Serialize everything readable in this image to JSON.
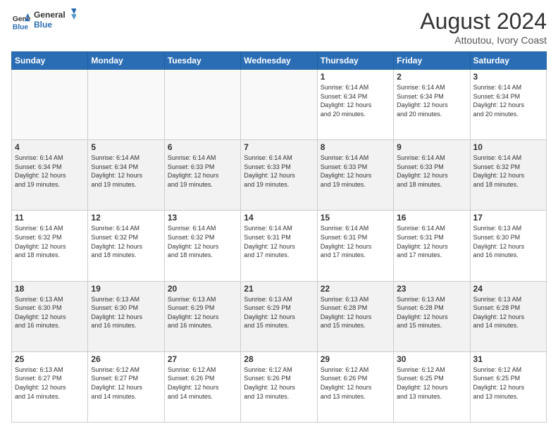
{
  "logo": {
    "line1": "General",
    "line2": "Blue"
  },
  "title": "August 2024",
  "subtitle": "Attoutou, Ivory Coast",
  "headers": [
    "Sunday",
    "Monday",
    "Tuesday",
    "Wednesday",
    "Thursday",
    "Friday",
    "Saturday"
  ],
  "weeks": [
    [
      {
        "day": "",
        "info": ""
      },
      {
        "day": "",
        "info": ""
      },
      {
        "day": "",
        "info": ""
      },
      {
        "day": "",
        "info": ""
      },
      {
        "day": "1",
        "info": "Sunrise: 6:14 AM\nSunset: 6:34 PM\nDaylight: 12 hours\nand 20 minutes."
      },
      {
        "day": "2",
        "info": "Sunrise: 6:14 AM\nSunset: 6:34 PM\nDaylight: 12 hours\nand 20 minutes."
      },
      {
        "day": "3",
        "info": "Sunrise: 6:14 AM\nSunset: 6:34 PM\nDaylight: 12 hours\nand 20 minutes."
      }
    ],
    [
      {
        "day": "4",
        "info": "Sunrise: 6:14 AM\nSunset: 6:34 PM\nDaylight: 12 hours\nand 19 minutes."
      },
      {
        "day": "5",
        "info": "Sunrise: 6:14 AM\nSunset: 6:34 PM\nDaylight: 12 hours\nand 19 minutes."
      },
      {
        "day": "6",
        "info": "Sunrise: 6:14 AM\nSunset: 6:33 PM\nDaylight: 12 hours\nand 19 minutes."
      },
      {
        "day": "7",
        "info": "Sunrise: 6:14 AM\nSunset: 6:33 PM\nDaylight: 12 hours\nand 19 minutes."
      },
      {
        "day": "8",
        "info": "Sunrise: 6:14 AM\nSunset: 6:33 PM\nDaylight: 12 hours\nand 19 minutes."
      },
      {
        "day": "9",
        "info": "Sunrise: 6:14 AM\nSunset: 6:33 PM\nDaylight: 12 hours\nand 18 minutes."
      },
      {
        "day": "10",
        "info": "Sunrise: 6:14 AM\nSunset: 6:32 PM\nDaylight: 12 hours\nand 18 minutes."
      }
    ],
    [
      {
        "day": "11",
        "info": "Sunrise: 6:14 AM\nSunset: 6:32 PM\nDaylight: 12 hours\nand 18 minutes."
      },
      {
        "day": "12",
        "info": "Sunrise: 6:14 AM\nSunset: 6:32 PM\nDaylight: 12 hours\nand 18 minutes."
      },
      {
        "day": "13",
        "info": "Sunrise: 6:14 AM\nSunset: 6:32 PM\nDaylight: 12 hours\nand 18 minutes."
      },
      {
        "day": "14",
        "info": "Sunrise: 6:14 AM\nSunset: 6:31 PM\nDaylight: 12 hours\nand 17 minutes."
      },
      {
        "day": "15",
        "info": "Sunrise: 6:14 AM\nSunset: 6:31 PM\nDaylight: 12 hours\nand 17 minutes."
      },
      {
        "day": "16",
        "info": "Sunrise: 6:14 AM\nSunset: 6:31 PM\nDaylight: 12 hours\nand 17 minutes."
      },
      {
        "day": "17",
        "info": "Sunrise: 6:13 AM\nSunset: 6:30 PM\nDaylight: 12 hours\nand 16 minutes."
      }
    ],
    [
      {
        "day": "18",
        "info": "Sunrise: 6:13 AM\nSunset: 6:30 PM\nDaylight: 12 hours\nand 16 minutes."
      },
      {
        "day": "19",
        "info": "Sunrise: 6:13 AM\nSunset: 6:30 PM\nDaylight: 12 hours\nand 16 minutes."
      },
      {
        "day": "20",
        "info": "Sunrise: 6:13 AM\nSunset: 6:29 PM\nDaylight: 12 hours\nand 16 minutes."
      },
      {
        "day": "21",
        "info": "Sunrise: 6:13 AM\nSunset: 6:29 PM\nDaylight: 12 hours\nand 15 minutes."
      },
      {
        "day": "22",
        "info": "Sunrise: 6:13 AM\nSunset: 6:28 PM\nDaylight: 12 hours\nand 15 minutes."
      },
      {
        "day": "23",
        "info": "Sunrise: 6:13 AM\nSunset: 6:28 PM\nDaylight: 12 hours\nand 15 minutes."
      },
      {
        "day": "24",
        "info": "Sunrise: 6:13 AM\nSunset: 6:28 PM\nDaylight: 12 hours\nand 14 minutes."
      }
    ],
    [
      {
        "day": "25",
        "info": "Sunrise: 6:13 AM\nSunset: 6:27 PM\nDaylight: 12 hours\nand 14 minutes."
      },
      {
        "day": "26",
        "info": "Sunrise: 6:12 AM\nSunset: 6:27 PM\nDaylight: 12 hours\nand 14 minutes."
      },
      {
        "day": "27",
        "info": "Sunrise: 6:12 AM\nSunset: 6:26 PM\nDaylight: 12 hours\nand 14 minutes."
      },
      {
        "day": "28",
        "info": "Sunrise: 6:12 AM\nSunset: 6:26 PM\nDaylight: 12 hours\nand 13 minutes."
      },
      {
        "day": "29",
        "info": "Sunrise: 6:12 AM\nSunset: 6:26 PM\nDaylight: 12 hours\nand 13 minutes."
      },
      {
        "day": "30",
        "info": "Sunrise: 6:12 AM\nSunset: 6:25 PM\nDaylight: 12 hours\nand 13 minutes."
      },
      {
        "day": "31",
        "info": "Sunrise: 6:12 AM\nSunset: 6:25 PM\nDaylight: 12 hours\nand 13 minutes."
      }
    ]
  ]
}
